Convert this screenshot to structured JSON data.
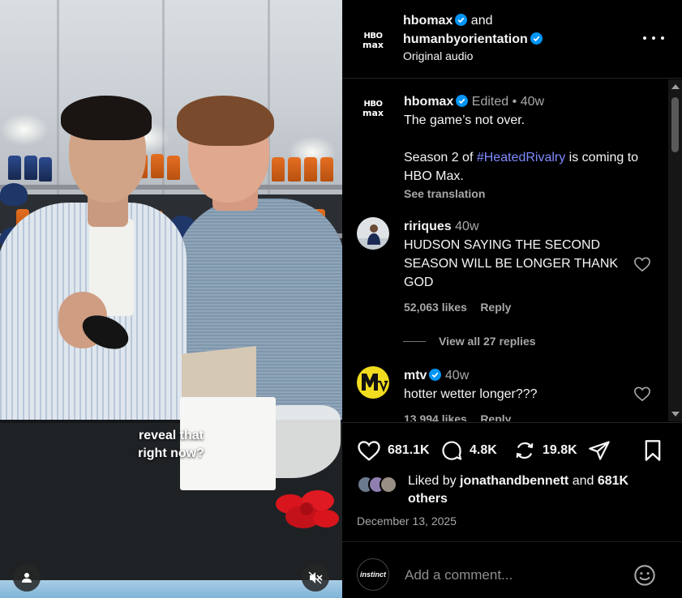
{
  "media": {
    "caption_line1": "reveal that",
    "caption_line2": "right now?",
    "profile_icon": "person-icon",
    "mute_icon": "speaker-muted-icon"
  },
  "header": {
    "user1": "hbomax",
    "and": "and",
    "user2": "humanbyorientation",
    "audio": "Original audio",
    "more_icon": "more-dots-icon"
  },
  "post": {
    "username": "hbomax",
    "edited": "Edited",
    "time": "40w",
    "line1": "The game’s not over.",
    "line2_pre": "Season 2 of ",
    "hashtag": "#HeatedRivalry",
    "line2_post": " is coming to HBO Max.",
    "see_translation": "See translation"
  },
  "comments": [
    {
      "username": "ririques",
      "time": "40w",
      "text": "HUDSON SAYING THE SECOND SEASON WILL BE LONGER THANK GOD",
      "likes": "52,063 likes",
      "reply": "Reply",
      "view_replies": "View all 27 replies"
    },
    {
      "username": "mtv",
      "time": "40w",
      "text": "hotter wetter longer???",
      "likes": "13,994 likes",
      "reply": "Reply"
    }
  ],
  "actions": {
    "likes_count": "681.1K",
    "comments_count": "4.8K",
    "reposts_count": "19.8K"
  },
  "liked_by": {
    "prefix": "Liked by ",
    "user": "jonathandbennett",
    "and": " and ",
    "count": "681K",
    "suffix": "others"
  },
  "date": "December 13, 2025",
  "add_comment": {
    "avatar_text": "instinct",
    "placeholder": "Add a comment..."
  },
  "colors": {
    "verified": "#0095f6",
    "hashtag": "#7e8bff",
    "secondary_text": "#a8a8a8",
    "background": "#000000"
  }
}
